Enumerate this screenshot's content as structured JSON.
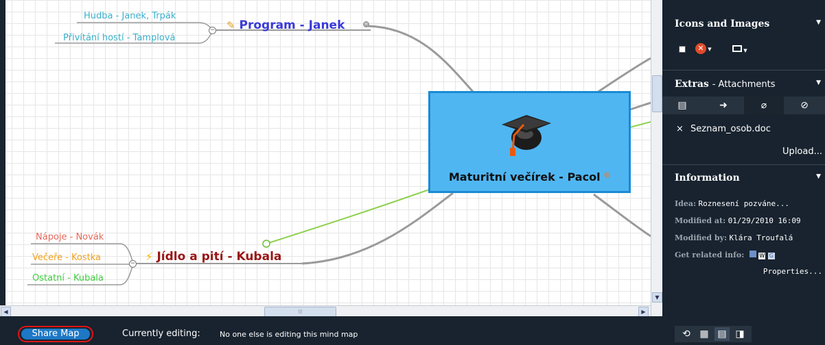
{
  "mindmap": {
    "central": {
      "title": "Maturitní večírek - Pacol",
      "icon": "graduation-cap-icon"
    },
    "branch_program": {
      "title": "Program - Janek",
      "color": "#3a3ad8",
      "icon": "pencil-icon",
      "children": [
        "Hudba - Janek, Trpák",
        "Přivítání hostí - Tamplová"
      ],
      "child_color": "#3ab0cc"
    },
    "branch_food": {
      "title": "Jídlo a pití - Kubala",
      "color": "#991515",
      "icon": "lightning-icon",
      "children": [
        {
          "label": "Nápoje - Novák",
          "color": "#e8685a"
        },
        {
          "label": "Večeře - Kostka",
          "color": "#f2a020"
        },
        {
          "label": "Ostatní - Kubala",
          "color": "#3dcc3d"
        }
      ]
    },
    "collapse_symbol": "−"
  },
  "sidebar": {
    "icons_title": "Icons and Images",
    "extras_title": "Extras",
    "extras_subtitle": "- Attachments",
    "attachment_remove": "×",
    "attachment_file": "Seznam_osob.doc",
    "upload_label": "Upload...",
    "info_title": "Information",
    "info": [
      {
        "label": "Idea:",
        "value": "Roznesení pozváne..."
      },
      {
        "label": "Modified at:",
        "value": "01/29/2010 16:09"
      },
      {
        "label": "Modified by:",
        "value": "Klára Troufalá"
      },
      {
        "label": "Get related info:",
        "value": ""
      }
    ],
    "properties_label": "Properties...",
    "chevron": "▼"
  },
  "bottombar": {
    "share_label": "Share Map",
    "editing_label": "Currently editing:",
    "editing_status": "No one else is editing this mind map"
  },
  "scroll": {
    "up": "▲",
    "down": "▼",
    "left": "◀",
    "right": "▶",
    "grip": "|||"
  }
}
